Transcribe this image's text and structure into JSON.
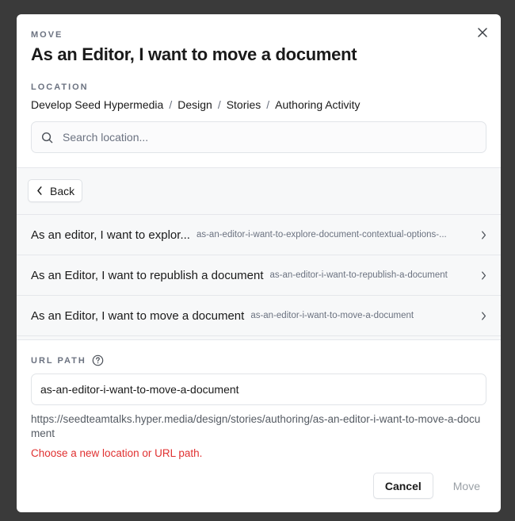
{
  "dialog": {
    "eyebrow": "MOVE",
    "title": "As an Editor, I want to move a document",
    "close_icon": "close-icon"
  },
  "location": {
    "label": "LOCATION",
    "breadcrumb": [
      "Develop Seed Hypermedia",
      "Design",
      "Stories",
      "Authoring Activity"
    ],
    "separator": "/"
  },
  "search": {
    "placeholder": "Search location...",
    "value": "",
    "icon": "search-icon"
  },
  "back": {
    "label": "Back",
    "icon": "chevron-left-icon"
  },
  "items": [
    {
      "title": "As an editor, I want to explor...",
      "slug": "as-an-editor-i-want-to-explore-document-contextual-options-..."
    },
    {
      "title": "As an Editor, I want to republish a document",
      "slug": "as-an-editor-i-want-to-republish-a-document"
    },
    {
      "title": "As an Editor, I want to move a document",
      "slug": "as-an-editor-i-want-to-move-a-document"
    }
  ],
  "url_path": {
    "label": "URL PATH",
    "value": "as-an-editor-i-want-to-move-a-document",
    "full_url": "https://seedteamtalks.hyper.media/design/stories/authoring/as-an-editor-i-want-to-move-a-document",
    "error": "Choose a new location or URL path."
  },
  "footer": {
    "cancel_label": "Cancel",
    "move_label": "Move"
  },
  "colors": {
    "error": "#e03131",
    "overlay": "#3a3a3a",
    "muted": "#6b7280"
  }
}
